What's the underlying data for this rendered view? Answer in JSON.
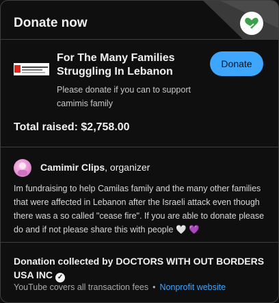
{
  "header": {
    "title": "Donate now",
    "logo_icon": "heart-hand-icon"
  },
  "campaign": {
    "title": "For The Many Families Struggling In Lebanon",
    "description": "Please donate if you can to support camimis family",
    "donate_label": "Donate",
    "total_raised": "Total raised: $2,758.00"
  },
  "organizer": {
    "name": "Camimir Clips",
    "role": ", organizer",
    "story": "Im fundraising to help Camilas family and the many other families that were affected in Lebanon after the Israeli attack even though there was a so called \"cease fire\". If you are able to donate please do and if not please share this with people 🤍 💜"
  },
  "collection": {
    "text": "Donation collected by DOCTORS WITH OUT BORDERS USA INC",
    "fees": "YouTube covers all transaction fees",
    "separator": "•",
    "link": "Nonprofit website"
  },
  "colors": {
    "accent": "#3ea6ff",
    "background": "#0f0f0f",
    "logo_green": "#3aa14a"
  }
}
